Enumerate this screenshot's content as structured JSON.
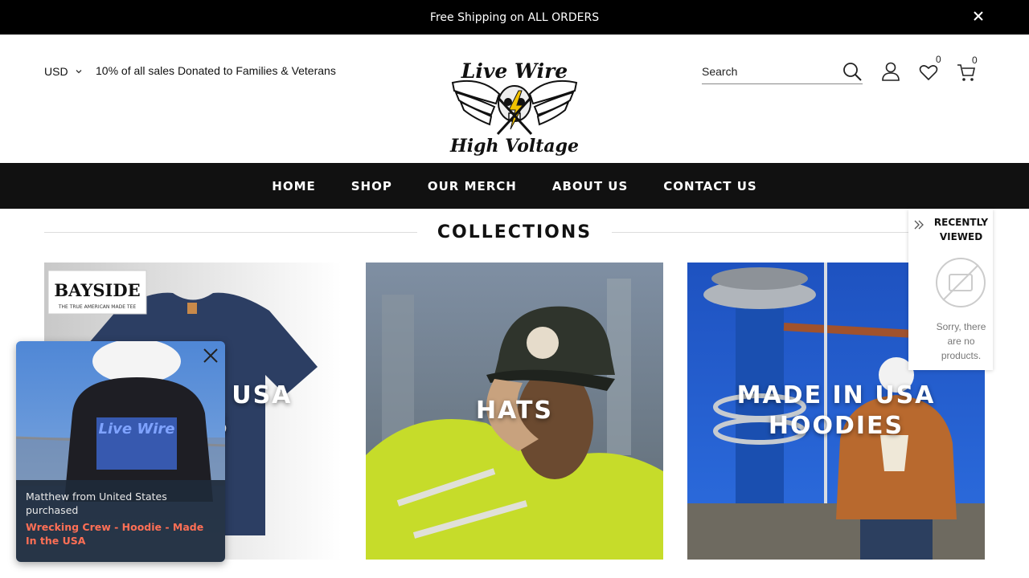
{
  "announcement": {
    "text": "Free Shipping on ALL ORDERS"
  },
  "header": {
    "currency": "USD",
    "tagline": "10% of all sales Donated to Families & Veterans",
    "logo": {
      "line1": "Live Wire",
      "line2": "High Voltage"
    },
    "search_label": "Search",
    "wishlist_count": "0",
    "cart_count": "0"
  },
  "nav": {
    "items": [
      {
        "label": "HOME"
      },
      {
        "label": "SHOP"
      },
      {
        "label": "OUR MERCH"
      },
      {
        "label": "ABOUT US"
      },
      {
        "label": "CONTACT US"
      }
    ]
  },
  "collections": {
    "heading": "COLLECTIONS",
    "cards": [
      {
        "title": "MADE IN USA TEES",
        "badge_main": "BAYSIDE",
        "badge_sub": "THE TRUE AMERICAN MADE TEE"
      },
      {
        "title": "HATS"
      },
      {
        "title": "MADE IN USA HOODIES"
      }
    ]
  },
  "recently_viewed": {
    "heading": "RECENTLY VIEWED",
    "empty_text": "Sorry, there are no products."
  },
  "popup": {
    "who": "Matthew from United States purchased",
    "product": "Wrecking Crew - Hoodie - Made In the USA"
  },
  "colors": {
    "black": "#000000",
    "nav_bg": "#111111",
    "popup_bg": "#1e2a3a",
    "popup_accent": "#ff6f55",
    "hi_vis": "#d4e82a",
    "sky": "#1f5fc8"
  }
}
